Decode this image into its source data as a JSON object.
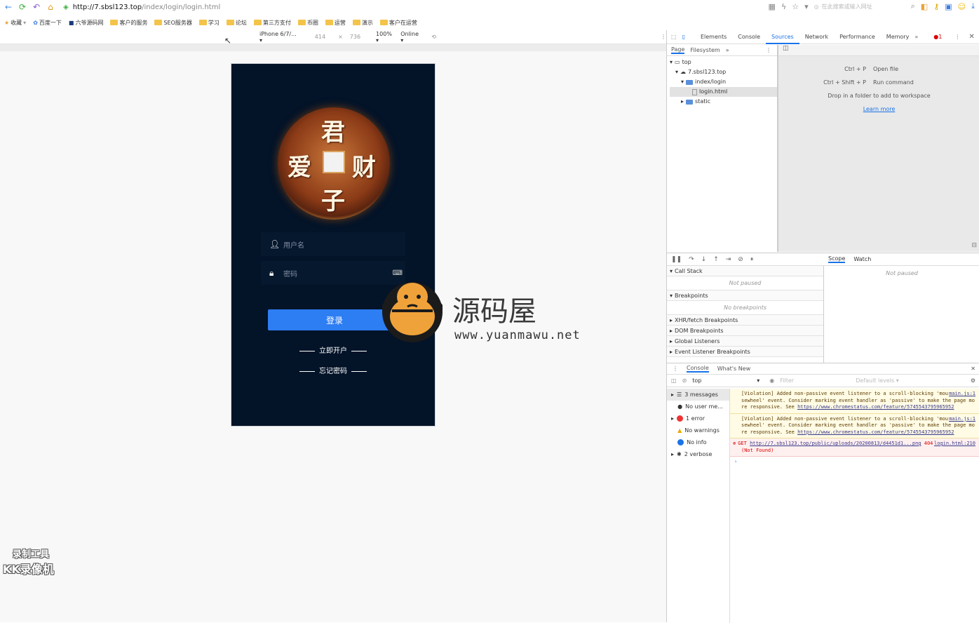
{
  "browser": {
    "url_host": "http://7.sbsl123.top",
    "url_path": "/index/login/login.html",
    "search_placeholder": "在此搜索或输入网址"
  },
  "bookmarks": [
    "收藏",
    "百度一下",
    "六爷源码网",
    "客户的服务",
    "SEO服务器",
    "学习",
    "论坛",
    "第三方支付",
    "币圈",
    "运营",
    "演示",
    "客户在运营"
  ],
  "device_toolbar": {
    "device": "iPhone 6/7/...",
    "width": "414",
    "height": "736",
    "zoom": "100%",
    "network": "Online"
  },
  "phone": {
    "coin_chars": [
      "君",
      "爱",
      "财",
      "子"
    ],
    "username_placeholder": "用户名",
    "password_placeholder": "密码",
    "login_label": "登录",
    "register_link": "立即开户",
    "forgot_link": "忘记密码"
  },
  "watermark": {
    "title": "源码屋",
    "url": "www.yuanmawu.net"
  },
  "recorder": {
    "line1": "录制工具",
    "line2": "KK录像机"
  },
  "devtools": {
    "tabs": [
      "Elements",
      "Console",
      "Sources",
      "Network",
      "Performance",
      "Memory"
    ],
    "active_tab": "Sources",
    "error_count": "1",
    "sub_tabs": [
      "Page",
      "Filesystem"
    ],
    "tree": [
      "top",
      "7.sbsl123.top",
      "index/login",
      "login.html",
      "static"
    ],
    "hints": [
      {
        "key": "Ctrl + P",
        "action": "Open file"
      },
      {
        "key": "Ctrl + Shift + P",
        "action": "Run command"
      }
    ],
    "drop_hint": "Drop in a folder to add to workspace",
    "learn_more": "Learn more",
    "call_stack": "Call Stack",
    "not_paused": "Not paused",
    "breakpoints": "Breakpoints",
    "no_breakpoints": "No breakpoints",
    "bp_sections": [
      "XHR/fetch Breakpoints",
      "DOM Breakpoints",
      "Global Listeners",
      "Event Listener Breakpoints"
    ],
    "scope_tabs": [
      "Scope",
      "Watch"
    ],
    "console_tabs": [
      "Console",
      "What's New"
    ],
    "context": "top",
    "filter_placeholder": "Filter",
    "levels": "Default levels",
    "side": [
      "3 messages",
      "No user me...",
      "1 error",
      "No warnings",
      "No info",
      "2 verbose"
    ],
    "messages": [
      {
        "type": "warn",
        "text": "[Violation] Added non-passive event listener to a scroll-blocking 'mousewheel' event. Consider marking event handler as 'passive' to make the page more responsive. See",
        "link": "https://www.chromestatus.com/feature/5745543795965952",
        "src": "main.js:1"
      },
      {
        "type": "warn",
        "text": "[Violation] Added non-passive event listener to a scroll-blocking 'mousewheel' event. Consider marking event handler as 'passive' to make the page more responsive. See",
        "link": "https://www.chromestatus.com/feature/5745543795965952",
        "src": "main.js:1"
      },
      {
        "type": "error",
        "text": "GET",
        "link": "http://7.sbsl123.top/public/uploads/20200813/d4451d1...png",
        "status": "404 (Not Found)",
        "src": "login.html:210"
      }
    ]
  }
}
